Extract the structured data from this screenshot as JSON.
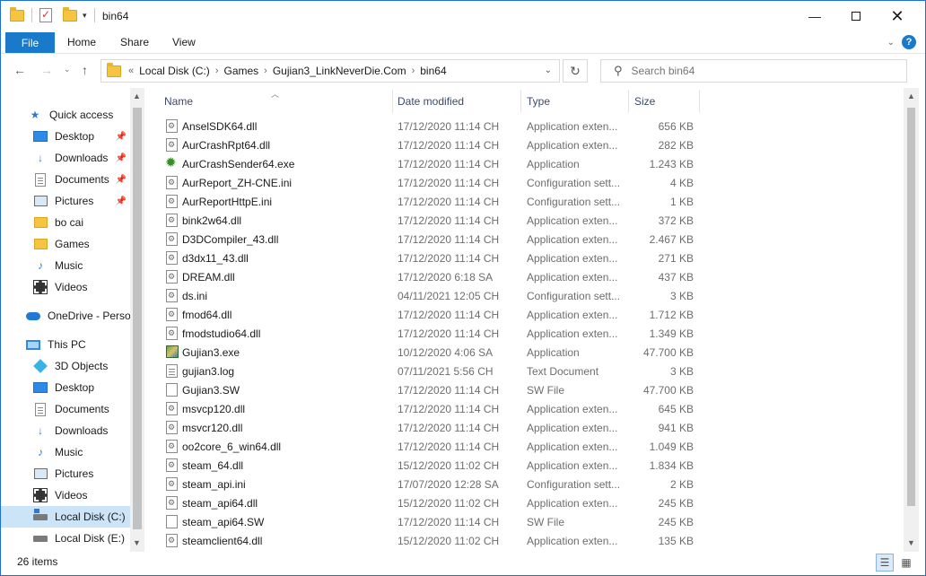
{
  "window": {
    "title": "bin64"
  },
  "ribbon": {
    "tabs": [
      "File",
      "Home",
      "Share",
      "View"
    ],
    "help": "?"
  },
  "nav": {
    "breadcrumb_prefix": "«",
    "path": [
      "Local Disk (C:)",
      "Games",
      "Gujian3_LinkNeverDie.Com",
      "bin64"
    ],
    "search_placeholder": "Search bin64"
  },
  "sidebar": {
    "items": [
      {
        "label": "Quick access",
        "icon": "star-icon",
        "pinned": false
      },
      {
        "label": "Desktop",
        "icon": "desktop-icon",
        "pinned": true
      },
      {
        "label": "Downloads",
        "icon": "download-icon",
        "pinned": true
      },
      {
        "label": "Documents",
        "icon": "documents-icon",
        "pinned": true
      },
      {
        "label": "Pictures",
        "icon": "pictures-icon",
        "pinned": true
      },
      {
        "label": "bo cai",
        "icon": "folder-icon",
        "pinned": false
      },
      {
        "label": "Games",
        "icon": "folder-icon",
        "pinned": false
      },
      {
        "label": "Music",
        "icon": "music-icon",
        "pinned": false
      },
      {
        "label": "Videos",
        "icon": "videos-icon",
        "pinned": false
      },
      {
        "label": "OneDrive - Persor",
        "icon": "onedrive-icon",
        "pinned": false
      },
      {
        "label": "This PC",
        "icon": "pc-icon",
        "pinned": false
      },
      {
        "label": "3D Objects",
        "icon": "3d-objects-icon",
        "pinned": false
      },
      {
        "label": "Desktop",
        "icon": "desktop-icon",
        "pinned": false
      },
      {
        "label": "Documents",
        "icon": "documents-icon",
        "pinned": false
      },
      {
        "label": "Downloads",
        "icon": "download-icon",
        "pinned": false
      },
      {
        "label": "Music",
        "icon": "music-icon",
        "pinned": false
      },
      {
        "label": "Pictures",
        "icon": "pictures-icon",
        "pinned": false
      },
      {
        "label": "Videos",
        "icon": "videos-icon",
        "pinned": false
      },
      {
        "label": "Local Disk (C:)",
        "icon": "drive-icon",
        "pinned": false,
        "selected": true
      },
      {
        "label": "Local Disk (E:)",
        "icon": "drive-icon",
        "pinned": false
      }
    ]
  },
  "columns": {
    "name": "Name",
    "date": "Date modified",
    "type": "Type",
    "size": "Size"
  },
  "files": [
    {
      "name": "AnselSDK64.dll",
      "date": "17/12/2020 11:14 CH",
      "type": "Application exten...",
      "size": "656 KB",
      "icon": "dll-file-icon"
    },
    {
      "name": "AurCrashRpt64.dll",
      "date": "17/12/2020 11:14 CH",
      "type": "Application exten...",
      "size": "282 KB",
      "icon": "dll-file-icon"
    },
    {
      "name": "AurCrashSender64.exe",
      "date": "17/12/2020 11:14 CH",
      "type": "Application",
      "size": "1.243 KB",
      "icon": "bug-exe-icon"
    },
    {
      "name": "AurReport_ZH-CNE.ini",
      "date": "17/12/2020 11:14 CH",
      "type": "Configuration sett...",
      "size": "4 KB",
      "icon": "ini-file-icon"
    },
    {
      "name": "AurReportHttpE.ini",
      "date": "17/12/2020 11:14 CH",
      "type": "Configuration sett...",
      "size": "1 KB",
      "icon": "ini-file-icon"
    },
    {
      "name": "bink2w64.dll",
      "date": "17/12/2020 11:14 CH",
      "type": "Application exten...",
      "size": "372 KB",
      "icon": "dll-file-icon"
    },
    {
      "name": "D3DCompiler_43.dll",
      "date": "17/12/2020 11:14 CH",
      "type": "Application exten...",
      "size": "2.467 KB",
      "icon": "dll-file-icon"
    },
    {
      "name": "d3dx11_43.dll",
      "date": "17/12/2020 11:14 CH",
      "type": "Application exten...",
      "size": "271 KB",
      "icon": "dll-file-icon"
    },
    {
      "name": "DREAM.dll",
      "date": "17/12/2020 6:18 SA",
      "type": "Application exten...",
      "size": "437 KB",
      "icon": "dll-file-icon"
    },
    {
      "name": "ds.ini",
      "date": "04/11/2021 12:05 CH",
      "type": "Configuration sett...",
      "size": "3 KB",
      "icon": "ini-file-icon"
    },
    {
      "name": "fmod64.dll",
      "date": "17/12/2020 11:14 CH",
      "type": "Application exten...",
      "size": "1.712 KB",
      "icon": "dll-file-icon"
    },
    {
      "name": "fmodstudio64.dll",
      "date": "17/12/2020 11:14 CH",
      "type": "Application exten...",
      "size": "1.349 KB",
      "icon": "dll-file-icon"
    },
    {
      "name": "Gujian3.exe",
      "date": "10/12/2020 4:06 SA",
      "type": "Application",
      "size": "47.700 KB",
      "icon": "game-exe-icon"
    },
    {
      "name": "gujian3.log",
      "date": "07/11/2021 5:56 CH",
      "type": "Text Document",
      "size": "3 KB",
      "icon": "text-file-icon"
    },
    {
      "name": "Gujian3.SW",
      "date": "17/12/2020 11:14 CH",
      "type": "SW File",
      "size": "47.700 KB",
      "icon": "blank-file-icon"
    },
    {
      "name": "msvcp120.dll",
      "date": "17/12/2020 11:14 CH",
      "type": "Application exten...",
      "size": "645 KB",
      "icon": "dll-file-icon"
    },
    {
      "name": "msvcr120.dll",
      "date": "17/12/2020 11:14 CH",
      "type": "Application exten...",
      "size": "941 KB",
      "icon": "dll-file-icon"
    },
    {
      "name": "oo2core_6_win64.dll",
      "date": "17/12/2020 11:14 CH",
      "type": "Application exten...",
      "size": "1.049 KB",
      "icon": "dll-file-icon"
    },
    {
      "name": "steam_64.dll",
      "date": "15/12/2020 11:02 CH",
      "type": "Application exten...",
      "size": "1.834 KB",
      "icon": "dll-file-icon"
    },
    {
      "name": "steam_api.ini",
      "date": "17/07/2020 12:28 SA",
      "type": "Configuration sett...",
      "size": "2 KB",
      "icon": "ini-file-icon"
    },
    {
      "name": "steam_api64.dll",
      "date": "15/12/2020 11:02 CH",
      "type": "Application exten...",
      "size": "245 KB",
      "icon": "dll-file-icon"
    },
    {
      "name": "steam_api64.SW",
      "date": "17/12/2020 11:14 CH",
      "type": "SW File",
      "size": "245 KB",
      "icon": "blank-file-icon"
    },
    {
      "name": "steamclient64.dll",
      "date": "15/12/2020 11:02 CH",
      "type": "Application exten...",
      "size": "135 KB",
      "icon": "dll-file-icon"
    }
  ],
  "status": {
    "item_count": "26 items"
  },
  "colors": {
    "accent": "#1979ca",
    "selection": "#cce4f7",
    "folder": "#f5c542"
  }
}
